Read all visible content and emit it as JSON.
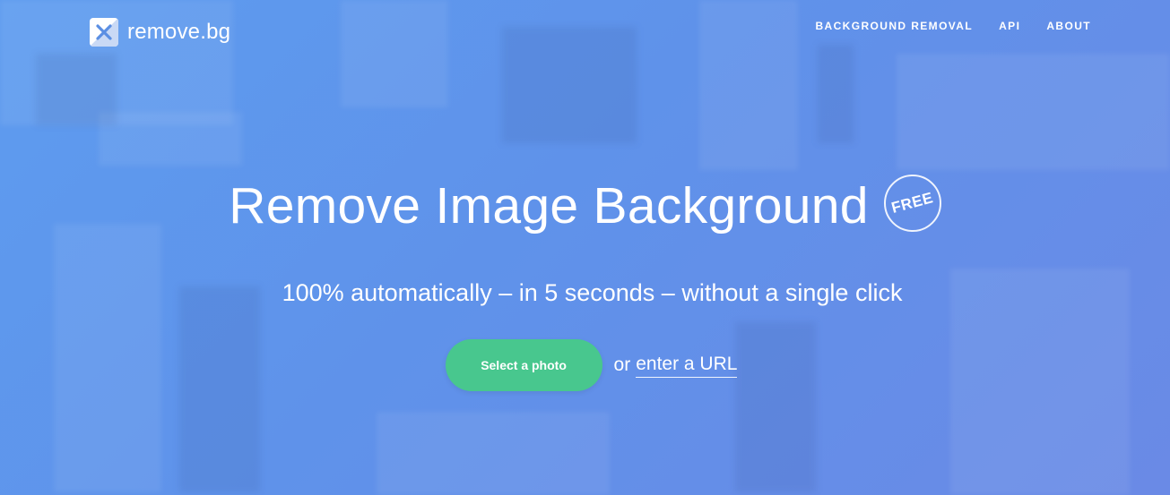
{
  "brand": {
    "name": "remove.bg",
    "logo_icon": "x-mark-icon"
  },
  "nav": {
    "items": [
      {
        "label": "BACKGROUND REMOVAL"
      },
      {
        "label": "API"
      },
      {
        "label": "ABOUT"
      }
    ]
  },
  "hero": {
    "title": "Remove Image Background",
    "badge": "FREE",
    "subtitle": "100% automatically – in 5 seconds – without a single click",
    "select_button": "Select a photo",
    "or_text": "or",
    "url_link": "enter a URL"
  },
  "colors": {
    "hero_gradient_start": "#5e9cef",
    "hero_gradient_end": "#6a8ae6",
    "button_green": "#48c78e",
    "text": "#ffffff"
  }
}
